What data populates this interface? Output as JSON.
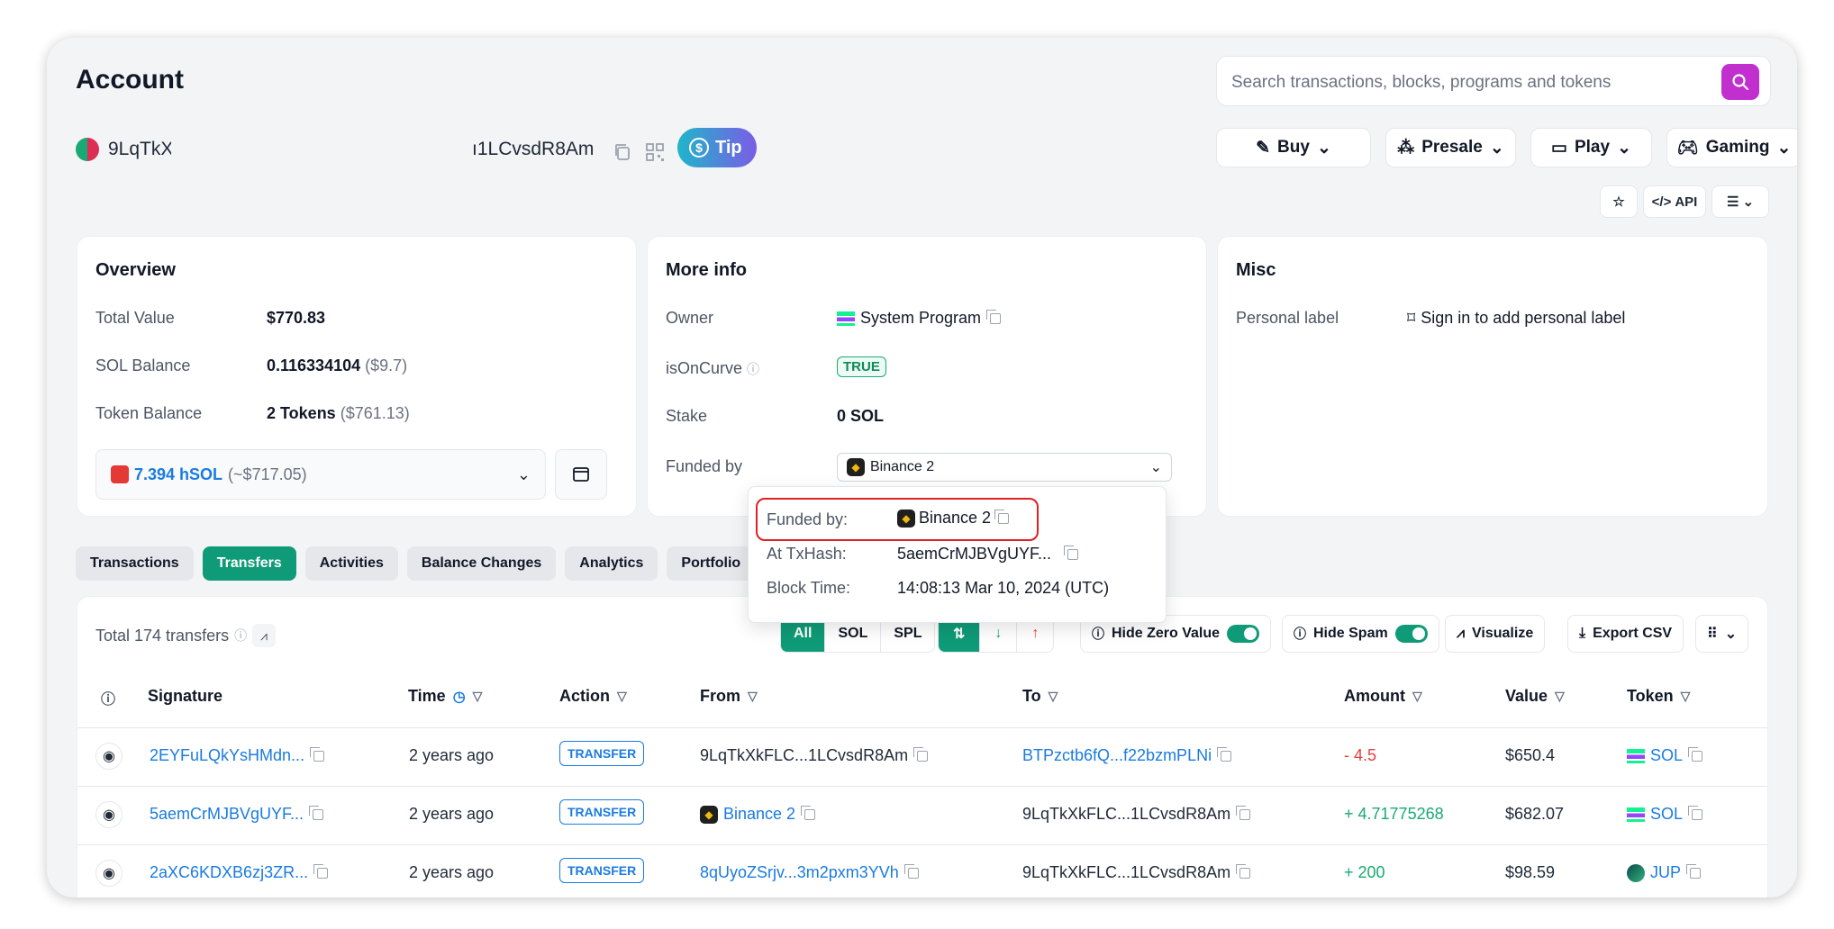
{
  "page": {
    "title": "Account"
  },
  "search": {
    "placeholder": "Search transactions, blocks, programs and tokens"
  },
  "account": {
    "address_left": "9LqTkX",
    "address_right": "ı1LCvsdR8Am",
    "tip_label": "Tip"
  },
  "nav": {
    "buy": "Buy",
    "presale": "Presale",
    "play": "Play",
    "gaming": "Gaming",
    "api": "API"
  },
  "overview": {
    "title": "Overview",
    "total_value_label": "Total Value",
    "total_value": "$770.83",
    "sol_balance_label": "SOL Balance",
    "sol_balance": "0.116334104",
    "sol_balance_usd": "($9.7)",
    "token_balance_label": "Token Balance",
    "token_balance": "2 Tokens",
    "token_balance_usd": "($761.13)",
    "token_select_amount": "7.394 hSOL",
    "token_select_usd": "(~$717.05)"
  },
  "more_info": {
    "title": "More info",
    "owner_label": "Owner",
    "owner_value": "System Program",
    "on_curve_label": "isOnCurve",
    "on_curve_value": "TRUE",
    "stake_label": "Stake",
    "stake_value": "0 SOL",
    "funded_label": "Funded by",
    "funded_value": "Binance 2"
  },
  "misc": {
    "title": "Misc",
    "personal_label": "Personal label",
    "personal_link": "Sign in to add personal label"
  },
  "popover": {
    "funded_by_label": "Funded by:",
    "funded_by_value": "Binance 2",
    "tx_hash_label": "At TxHash:",
    "tx_hash_value": "5aemCrMJBVgUYF...",
    "block_time_label": "Block Time:",
    "block_time_value": "14:08:13 Mar 10, 2024 (UTC)"
  },
  "tabs": [
    "Transactions",
    "Transfers",
    "Activities",
    "Balance Changes",
    "Analytics",
    "Portfolio"
  ],
  "transfers": {
    "total_label": "Total 174 transfers",
    "filter_all": "All",
    "filter_sol": "SOL",
    "filter_spl": "SPL",
    "hide_zero": "Hide Zero Value",
    "hide_spam": "Hide Spam",
    "visualize": "Visualize",
    "export": "Export CSV",
    "columns": {
      "signature": "Signature",
      "time": "Time",
      "action": "Action",
      "from": "From",
      "to": "To",
      "amount": "Amount",
      "value": "Value",
      "token": "Token"
    },
    "rows": [
      {
        "signature": "2EYFuLQkYsHMdn...",
        "time": "2 years ago",
        "action": "TRANSFER",
        "from": "9LqTkXkFLC...1LCvsdR8Am",
        "to": "BTPzctb6fQ...f22bzmPLNi",
        "amount": "- 4.5",
        "value": "$650.4",
        "token": "SOL"
      },
      {
        "signature": "5aemCrMJBVgUYF...",
        "time": "2 years ago",
        "action": "TRANSFER",
        "from": "Binance 2",
        "to": "9LqTkXkFLC...1LCvsdR8Am",
        "amount": "+ 4.71775268",
        "value": "$682.07",
        "token": "SOL"
      },
      {
        "signature": "2aXC6KDXB6zj3ZR...",
        "time": "2 years ago",
        "action": "TRANSFER",
        "from": "8qUyoZSrjv...3m2pxm3YVh",
        "to": "9LqTkXkFLC...1LCvsdR8Am",
        "amount": "+ 200",
        "value": "$98.59",
        "token": "JUP"
      }
    ]
  }
}
